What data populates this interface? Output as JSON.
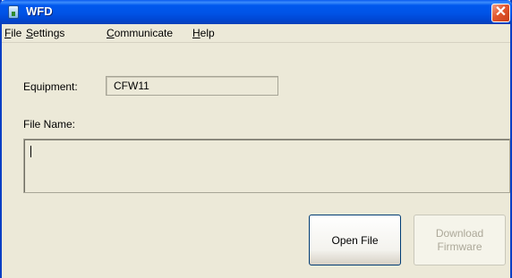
{
  "window": {
    "title": "WFD",
    "close_glyph": "✕"
  },
  "menu": [
    {
      "mnemonic": "F",
      "rest": "ile"
    },
    {
      "mnemonic": "S",
      "rest": "ettings"
    },
    {
      "mnemonic": "C",
      "rest": "ommunicate"
    },
    {
      "mnemonic": "H",
      "rest": "elp"
    }
  ],
  "form": {
    "equipment_label": "Equipment:",
    "equipment_value": "CFW11",
    "file_name_label": "File Name:",
    "file_name_value": ""
  },
  "buttons": {
    "open_file": "Open File",
    "download_line1": "Download",
    "download_line2": "Firmware"
  },
  "colors": {
    "titlebar": "#0053e6",
    "face": "#ece9d8",
    "close": "#e2562e"
  },
  "icons": {
    "app": "app-icon",
    "close": "close-icon"
  }
}
